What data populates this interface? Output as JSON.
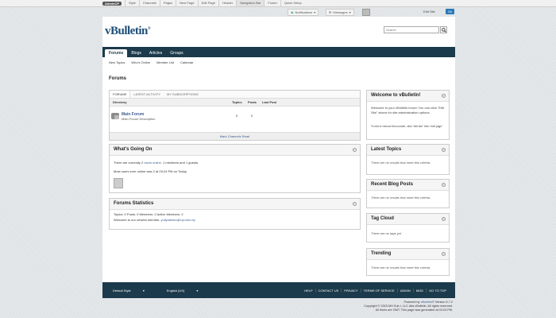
{
  "adminbar": {
    "admincp": "AdminCP",
    "items": [
      "Style",
      "Channels",
      "Pages",
      "New Page",
      "Edit Page",
      "Header",
      "Navigation Bar",
      "Footer",
      "Quick Setup"
    ]
  },
  "notifbar": {
    "notifications": "Notifications",
    "messages": "Messages",
    "edit_site": "Edit Site",
    "toggle": "On"
  },
  "header": {
    "logo": "vBulletin",
    "logo_mark": "®",
    "search_placeholder": "Search"
  },
  "nav": {
    "tabs": [
      "Forums",
      "Blogs",
      "Articles",
      "Groups"
    ],
    "subnav": [
      "New Topics",
      "Who's Online",
      "Member List",
      "Calendar"
    ]
  },
  "page": {
    "title": "Forums"
  },
  "forums_block": {
    "tabs": [
      "FORUMS",
      "LATEST ACTIVITY",
      "MY SUBSCRIPTIONS"
    ],
    "columns": {
      "directory": "Directory",
      "topics": "Topics",
      "posts": "Posts",
      "last_post": "Last Post"
    },
    "forum": {
      "name": "Main Forum",
      "description": "Main Forum Description",
      "topics": "0",
      "posts": "0"
    },
    "mark_read": "Mark Channels Read"
  },
  "whats_going_on": {
    "title": "What's Going On",
    "line1_pre": "There are currently 2",
    "line1_link": "users online",
    "line1_post": ". 1 members and 1 guests.",
    "line2": "Most users ever online was 2 at 03:24 PM on Today."
  },
  "forum_stats": {
    "title": "Forums Statistics",
    "line1": "Topics: 0   Posts: 0   Members: 2   Active Members: 2",
    "line2_pre": "Welcome to our newest member,",
    "newest_member": "yuliyadreko@i-promo.by"
  },
  "sidebar": {
    "welcome": {
      "title": "Welcome to vBulletin!",
      "text1": "Welcome to your vBulletin forum! You can click \"Edit Site\" above for site administration options.",
      "text2": "To edit or remove this module, click \"edit site\" then \"edit page\""
    },
    "latest_topics": {
      "title": "Latest Topics",
      "empty": "There are no results that meet this criteria."
    },
    "recent_blog_posts": {
      "title": "Recent Blog Posts",
      "empty": "There are no results that meet this criteria."
    },
    "tag_cloud": {
      "title": "Tag Cloud",
      "empty": "There are no tags yet"
    },
    "trending": {
      "title": "Trending",
      "empty": "There are no results that meet this criteria."
    }
  },
  "footer": {
    "style": "Default Style",
    "language": "English (US)",
    "links": [
      "HELP",
      "CONTACT US",
      "PRIVACY",
      "TERMS OF SERVICE",
      "ADMIN",
      "MOD",
      "GO TO TOP"
    ],
    "powered_pre": "Powered by",
    "powered_link": "vBulletin®",
    "powered_post": "Version 5.7.2",
    "copyright": "Copyright © 2023 MH Sub I, LLC dba vBulletin. All rights reserved.",
    "time": "All times are GMT. This page was generated at 03:24 PM."
  },
  "colors": {
    "nav_bg": "#1b3a4b",
    "link": "#3e5c92",
    "accent": "#2b79b8"
  }
}
